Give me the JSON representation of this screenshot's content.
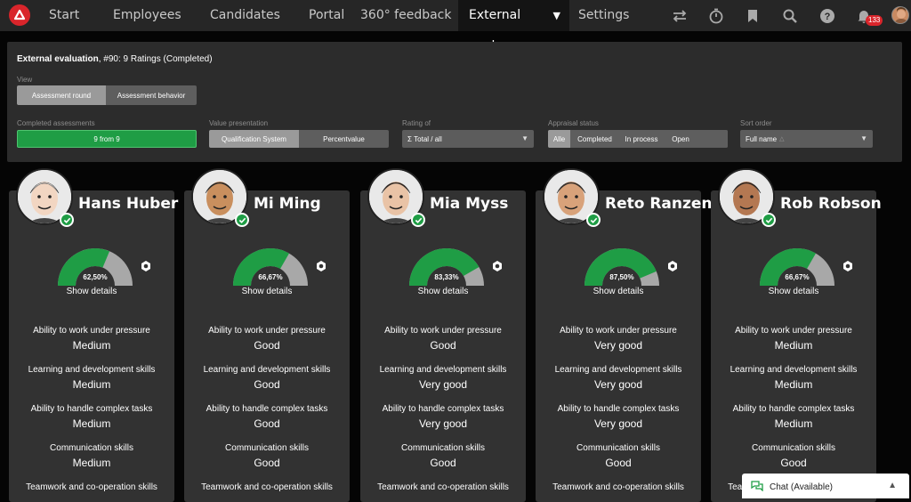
{
  "nav": {
    "items": [
      "Start",
      "Employees",
      "Candidates",
      "Portal",
      "360° feedback",
      "External evalu...",
      "Settings"
    ],
    "notification_count": "133"
  },
  "panel": {
    "title_bold": "External evaluation",
    "title_rest": ", #90: 9 Ratings (Completed)",
    "view_label": "View",
    "view_options": [
      "Assessment round",
      "Assessment behavior"
    ],
    "completed_label": "Completed assessments",
    "completed_value": "9 from 9",
    "value_pres_label": "Value presentation",
    "value_pres_options": [
      "Qualification System",
      "Percentvalue"
    ],
    "rating_label": "Rating of",
    "rating_value": "Σ Total / all",
    "status_label": "Appraisal status",
    "status_options": [
      "Alle",
      "Completed",
      "In process",
      "Open"
    ],
    "sort_label": "Sort order",
    "sort_value": "Full name"
  },
  "cards": [
    {
      "name": "Hans Huber",
      "pct": "62,50%",
      "pct_value": 62.5,
      "details": "Show details",
      "ratings": [
        [
          "Ability to work under pressure",
          "Medium"
        ],
        [
          "Learning and development skills",
          "Medium"
        ],
        [
          "Ability to handle complex tasks",
          "Medium"
        ],
        [
          "Communication skills",
          "Medium"
        ],
        [
          "Teamwork and co-operation skills",
          ""
        ]
      ]
    },
    {
      "name": "Mi Ming",
      "pct": "66,67%",
      "pct_value": 66.67,
      "details": "Show details",
      "ratings": [
        [
          "Ability to work under pressure",
          "Good"
        ],
        [
          "Learning and development skills",
          "Good"
        ],
        [
          "Ability to handle complex tasks",
          "Good"
        ],
        [
          "Communication skills",
          "Good"
        ],
        [
          "Teamwork and co-operation skills",
          ""
        ]
      ]
    },
    {
      "name": "Mia Myss",
      "pct": "83,33%",
      "pct_value": 83.33,
      "details": "Show details",
      "ratings": [
        [
          "Ability to work under pressure",
          "Good"
        ],
        [
          "Learning and development skills",
          "Very good"
        ],
        [
          "Ability to handle complex tasks",
          "Very good"
        ],
        [
          "Communication skills",
          "Good"
        ],
        [
          "Teamwork and co-operation skills",
          ""
        ]
      ]
    },
    {
      "name": "Reto Ranzen",
      "pct": "87,50%",
      "pct_value": 87.5,
      "details": "Show details",
      "ratings": [
        [
          "Ability to work under pressure",
          "Very good"
        ],
        [
          "Learning and development skills",
          "Very good"
        ],
        [
          "Ability to handle complex tasks",
          "Very good"
        ],
        [
          "Communication skills",
          "Good"
        ],
        [
          "Teamwork and co-operation skills",
          ""
        ]
      ]
    },
    {
      "name": "Rob Robson",
      "pct": "66,67%",
      "pct_value": 66.67,
      "details": "Show details",
      "ratings": [
        [
          "Ability to work under pressure",
          "Medium"
        ],
        [
          "Learning and development skills",
          "Medium"
        ],
        [
          "Ability to handle complex tasks",
          "Medium"
        ],
        [
          "Communication skills",
          "Good"
        ],
        [
          "Teamwork and co-operation skills",
          ""
        ]
      ]
    }
  ],
  "chat": {
    "label": "Chat (Available)"
  },
  "colors": {
    "accent_green": "#1f9d45",
    "gauge_gray": "#a8a8a8",
    "brand_red": "#d9252b"
  }
}
